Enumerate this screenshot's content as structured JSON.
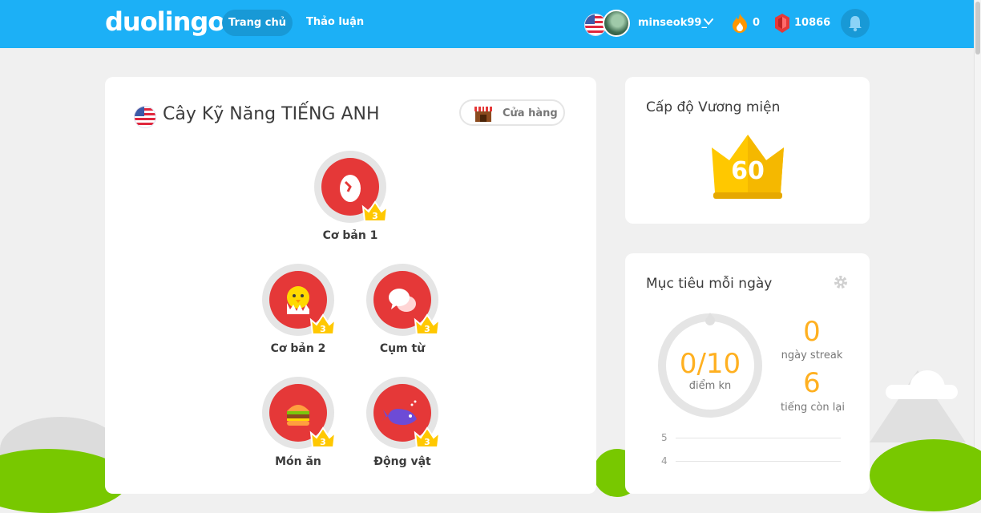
{
  "header": {
    "logo": "duolingo",
    "nav": [
      {
        "label": "Trang chủ",
        "active": true
      },
      {
        "label": "Thảo luận",
        "active": false
      }
    ],
    "username": "minseok99_",
    "streak": "0",
    "gems": "10866",
    "accent": "#1cb0f6"
  },
  "tree": {
    "title": "Cây Kỹ Năng TIẾNG ANH",
    "shop_label": "Cửa hàng",
    "skills": [
      {
        "label": "Cơ bản 1",
        "crown": "3",
        "icon": "egg-icon"
      },
      {
        "label": "Cơ bản 2",
        "crown": "3",
        "icon": "chick-icon"
      },
      {
        "label": "Cụm từ",
        "crown": "3",
        "icon": "speech-bubbles-icon"
      },
      {
        "label": "Món ăn",
        "crown": "3",
        "icon": "burger-icon"
      },
      {
        "label": "Động vật",
        "crown": "3",
        "icon": "whale-icon"
      }
    ]
  },
  "crown_card": {
    "title": "Cấp độ Vương miện",
    "level": "60"
  },
  "goal_card": {
    "title": "Mục tiêu mỗi ngày",
    "xp": "0/10",
    "xp_unit": "điểm kn",
    "streak_value": "0",
    "streak_label": "ngày streak",
    "words_left": "6",
    "words_left_label": "tiếng còn lại",
    "chart_ticks": [
      "5",
      "4"
    ]
  }
}
